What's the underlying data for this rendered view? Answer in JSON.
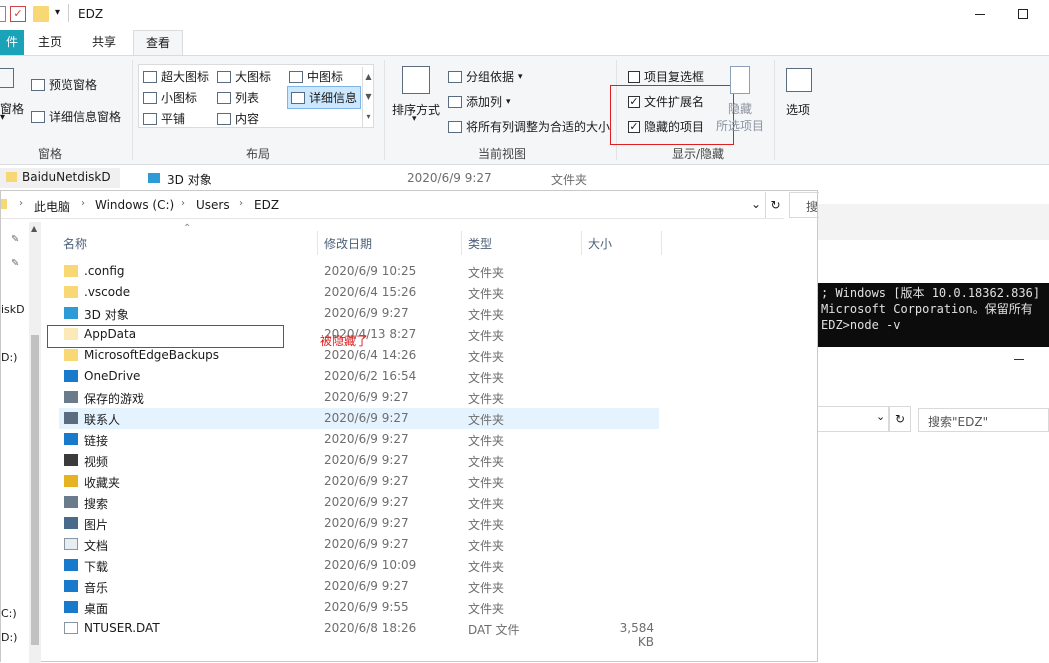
{
  "window": {
    "title": "EDZ"
  },
  "ribbon_tabs": [
    "件",
    "主页",
    "共享",
    "查看"
  ],
  "ribbon": {
    "pane": {
      "preview": "预览窗格",
      "details": "详细信息窗格",
      "left_cut_1": "窗格",
      "left_cut_2": "窗格",
      "group": "窗格"
    },
    "layout": {
      "items": [
        "超大图标",
        "大图标",
        "中图标",
        "小图标",
        "列表",
        "详细信息",
        "平铺",
        "内容"
      ],
      "group": "布局"
    },
    "current_view": {
      "sort": "排序方式",
      "group_by": "分组依据",
      "add_column": "添加列",
      "fit_columns": "将所有列调整为合适的大小",
      "group": "当前视图"
    },
    "show_hide": {
      "item_checkboxes": "项目复选框",
      "file_extensions": "文件扩展名",
      "hidden_items": "隐藏的项目",
      "hide_selected_1": "隐藏",
      "hide_selected_2": "所选项目",
      "group": "显示/隐藏"
    },
    "options": "选项"
  },
  "bg_window": {
    "sidebar_item": "BaiduNetdiskD",
    "row_name": "3D 对象",
    "row_date": "2020/6/9 9:27",
    "row_type": "文件夹",
    "search_placeholder": "搜索\"EDZ\"",
    "search_cut": "搜"
  },
  "cmd_lines": [
    "; Windows [版本 10.0.18362.836]",
    "Microsoft Corporation。保留所有",
    "",
    "EDZ>node -v"
  ],
  "address": {
    "crumbs": [
      "此电脑",
      "Windows (C:)",
      "Users",
      "EDZ"
    ]
  },
  "columns": {
    "name": "名称",
    "date": "修改日期",
    "type": "类型",
    "size": "大小"
  },
  "nav_items": [
    "iskD",
    "D:)",
    "C:)",
    "D:)"
  ],
  "annotation": "被隐藏了",
  "files": [
    {
      "name": ".config",
      "date": "2020/6/9 10:25",
      "type": "文件夹",
      "size": "",
      "icon": "folder-icon"
    },
    {
      "name": ".vscode",
      "date": "2020/6/4 15:26",
      "type": "文件夹",
      "size": "",
      "icon": "folder-icon"
    },
    {
      "name": "3D 对象",
      "date": "2020/6/9 9:27",
      "type": "文件夹",
      "size": "",
      "icon": "3d-objects-icon"
    },
    {
      "name": "AppData",
      "date": "2020/4/13 8:27",
      "type": "文件夹",
      "size": "",
      "icon": "folder-faded-icon"
    },
    {
      "name": "MicrosoftEdgeBackups",
      "date": "2020/6/4 14:26",
      "type": "文件夹",
      "size": "",
      "icon": "folder-icon"
    },
    {
      "name": "OneDrive",
      "date": "2020/6/2 16:54",
      "type": "文件夹",
      "size": "",
      "icon": "cloud-icon"
    },
    {
      "name": "保存的游戏",
      "date": "2020/6/9 9:27",
      "type": "文件夹",
      "size": "",
      "icon": "games-icon"
    },
    {
      "name": "联系人",
      "date": "2020/6/9 9:27",
      "type": "文件夹",
      "size": "",
      "icon": "contacts-icon"
    },
    {
      "name": "链接",
      "date": "2020/6/9 9:27",
      "type": "文件夹",
      "size": "",
      "icon": "links-icon"
    },
    {
      "name": "视频",
      "date": "2020/6/9 9:27",
      "type": "文件夹",
      "size": "",
      "icon": "video-icon"
    },
    {
      "name": "收藏夹",
      "date": "2020/6/9 9:27",
      "type": "文件夹",
      "size": "",
      "icon": "star-icon"
    },
    {
      "name": "搜索",
      "date": "2020/6/9 9:27",
      "type": "文件夹",
      "size": "",
      "icon": "search-icon"
    },
    {
      "name": "图片",
      "date": "2020/6/9 9:27",
      "type": "文件夹",
      "size": "",
      "icon": "pictures-icon"
    },
    {
      "name": "文档",
      "date": "2020/6/9 9:27",
      "type": "文件夹",
      "size": "",
      "icon": "document-icon"
    },
    {
      "name": "下载",
      "date": "2020/6/9 10:09",
      "type": "文件夹",
      "size": "",
      "icon": "download-icon"
    },
    {
      "name": "音乐",
      "date": "2020/6/9 9:27",
      "type": "文件夹",
      "size": "",
      "icon": "music-icon"
    },
    {
      "name": "桌面",
      "date": "2020/6/9 9:55",
      "type": "文件夹",
      "size": "",
      "icon": "desktop-icon"
    },
    {
      "name": "NTUSER.DAT",
      "date": "2020/6/8 18:26",
      "type": "DAT 文件",
      "size": "3,584 KB",
      "icon": "file-icon"
    }
  ],
  "colors": {
    "accent": "#1979ca",
    "tab_file": "#19a2b8",
    "annotation": "#e02020",
    "folder": "#f8d775"
  }
}
